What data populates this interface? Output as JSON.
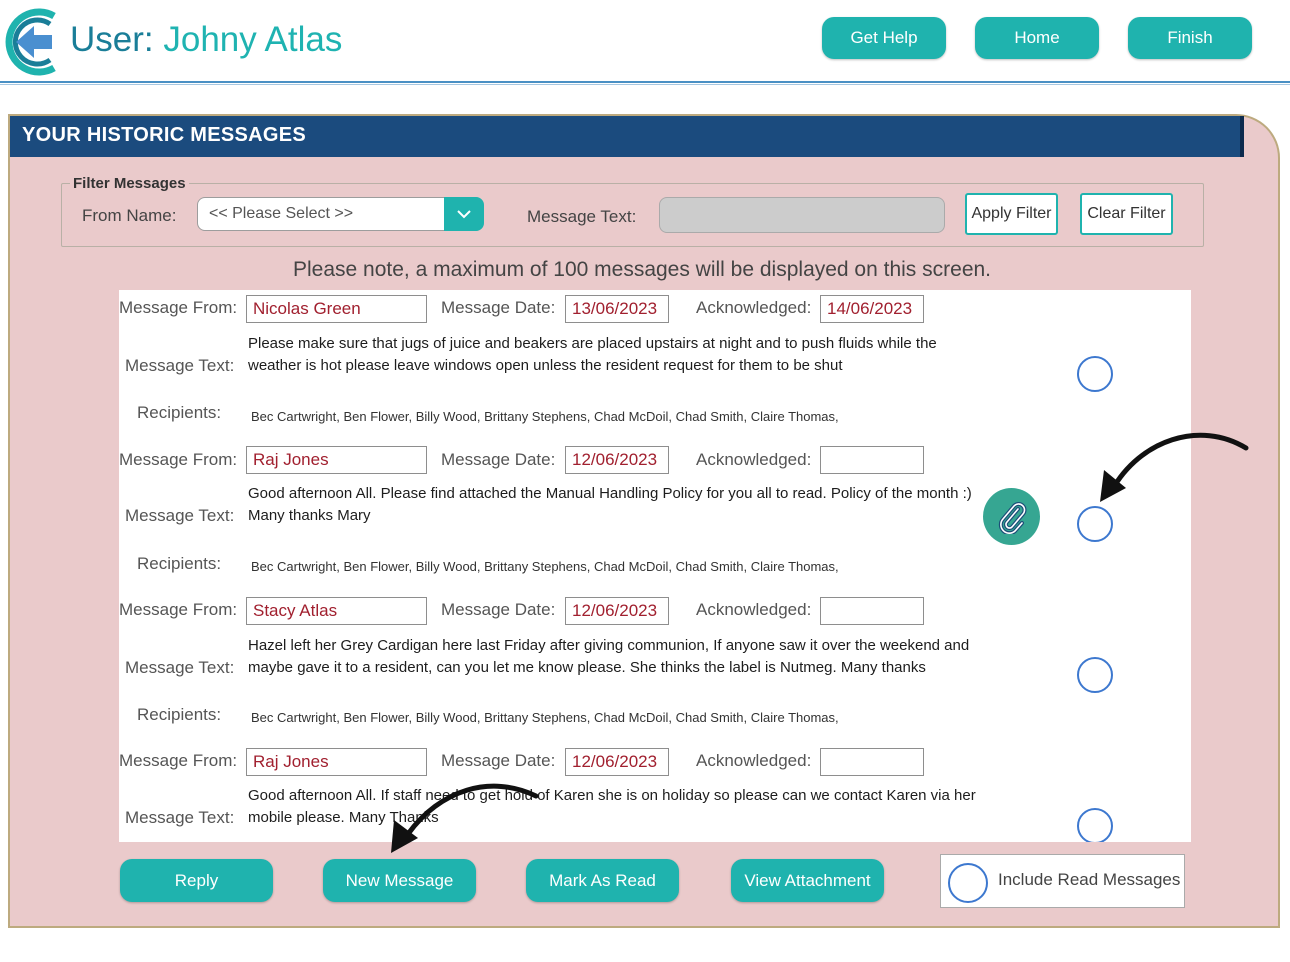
{
  "header": {
    "user_label": "User: ",
    "user_name": "Johny Atlas",
    "buttons": {
      "get_help": "Get Help",
      "home": "Home",
      "finish": "Finish"
    }
  },
  "panel": {
    "title": "YOUR HISTORIC MESSAGES",
    "filter": {
      "legend": "Filter Messages",
      "from_name_label": "From Name:",
      "from_name_selected": "<< Please Select >>",
      "message_text_label": "Message Text:",
      "message_text_value": "",
      "apply_label": "Apply Filter",
      "clear_label": "Clear Filter"
    },
    "note": "Please note, a maximum of 100 messages will be displayed on this screen."
  },
  "labels": {
    "from": "Message From:",
    "date": "Message Date:",
    "ack": "Acknowledged:",
    "text": "Message Text:",
    "recipients": "Recipients:"
  },
  "messages": [
    {
      "from": "Nicolas Green",
      "date": "13/06/2023",
      "acknowledged": "14/06/2023",
      "text": "Please make sure that jugs of juice and beakers are placed upstairs at night and to push fluids  while the weather is hot please leave windows open unless the resident request for them to be shut",
      "recipients": "Bec Cartwright, Ben Flower, Billy Wood, Brittany Stephens, Chad McDoil, Chad Smith, Claire Thomas,"
    },
    {
      "from": "Raj Jones",
      "date": "12/06/2023",
      "acknowledged": "",
      "text": "Good afternoon All.    Please find attached the Manual Handling Policy for you all to read.    Policy of the month :)    Many thanks    Mary",
      "recipients": "Bec Cartwright, Ben Flower, Billy Wood, Brittany Stephens, Chad McDoil, Chad Smith, Claire Thomas,",
      "has_attachment": true
    },
    {
      "from": "Stacy Atlas",
      "date": "12/06/2023",
      "acknowledged": "",
      "text": "Hazel left her Grey Cardigan here last Friday after giving communion, If anyone saw it over the weekend and maybe gave it to a resident, can you let me know please. She thinks the label is Nutmeg. Many thanks",
      "recipients": "Bec Cartwright, Ben Flower, Billy Wood, Brittany Stephens, Chad McDoil, Chad Smith, Claire Thomas,"
    },
    {
      "from": "Raj Jones",
      "date": "12/06/2023",
      "acknowledged": "",
      "text": "Good afternoon All.    If staff need to get hold of Karen she is on holiday so please can we contact Karen via her mobile please.    Many Thanks"
    }
  ],
  "actions": {
    "reply": "Reply",
    "new_message": "New Message",
    "mark_as_read": "Mark As Read",
    "view_attachment": "View Attachment",
    "include_read": "Include Read Messages"
  },
  "icons": {
    "logo": "back-arrow-logo-icon",
    "dropdown": "chevron-down-icon",
    "attachment": "paperclip-icon",
    "annotation": "curved-arrow-icon"
  },
  "colors": {
    "teal": "#1fb3ae",
    "navy_header": "#1b4b7e",
    "panel_bg": "#eacacb",
    "value_red": "#a1202f",
    "radio_blue": "#3d78cf"
  }
}
